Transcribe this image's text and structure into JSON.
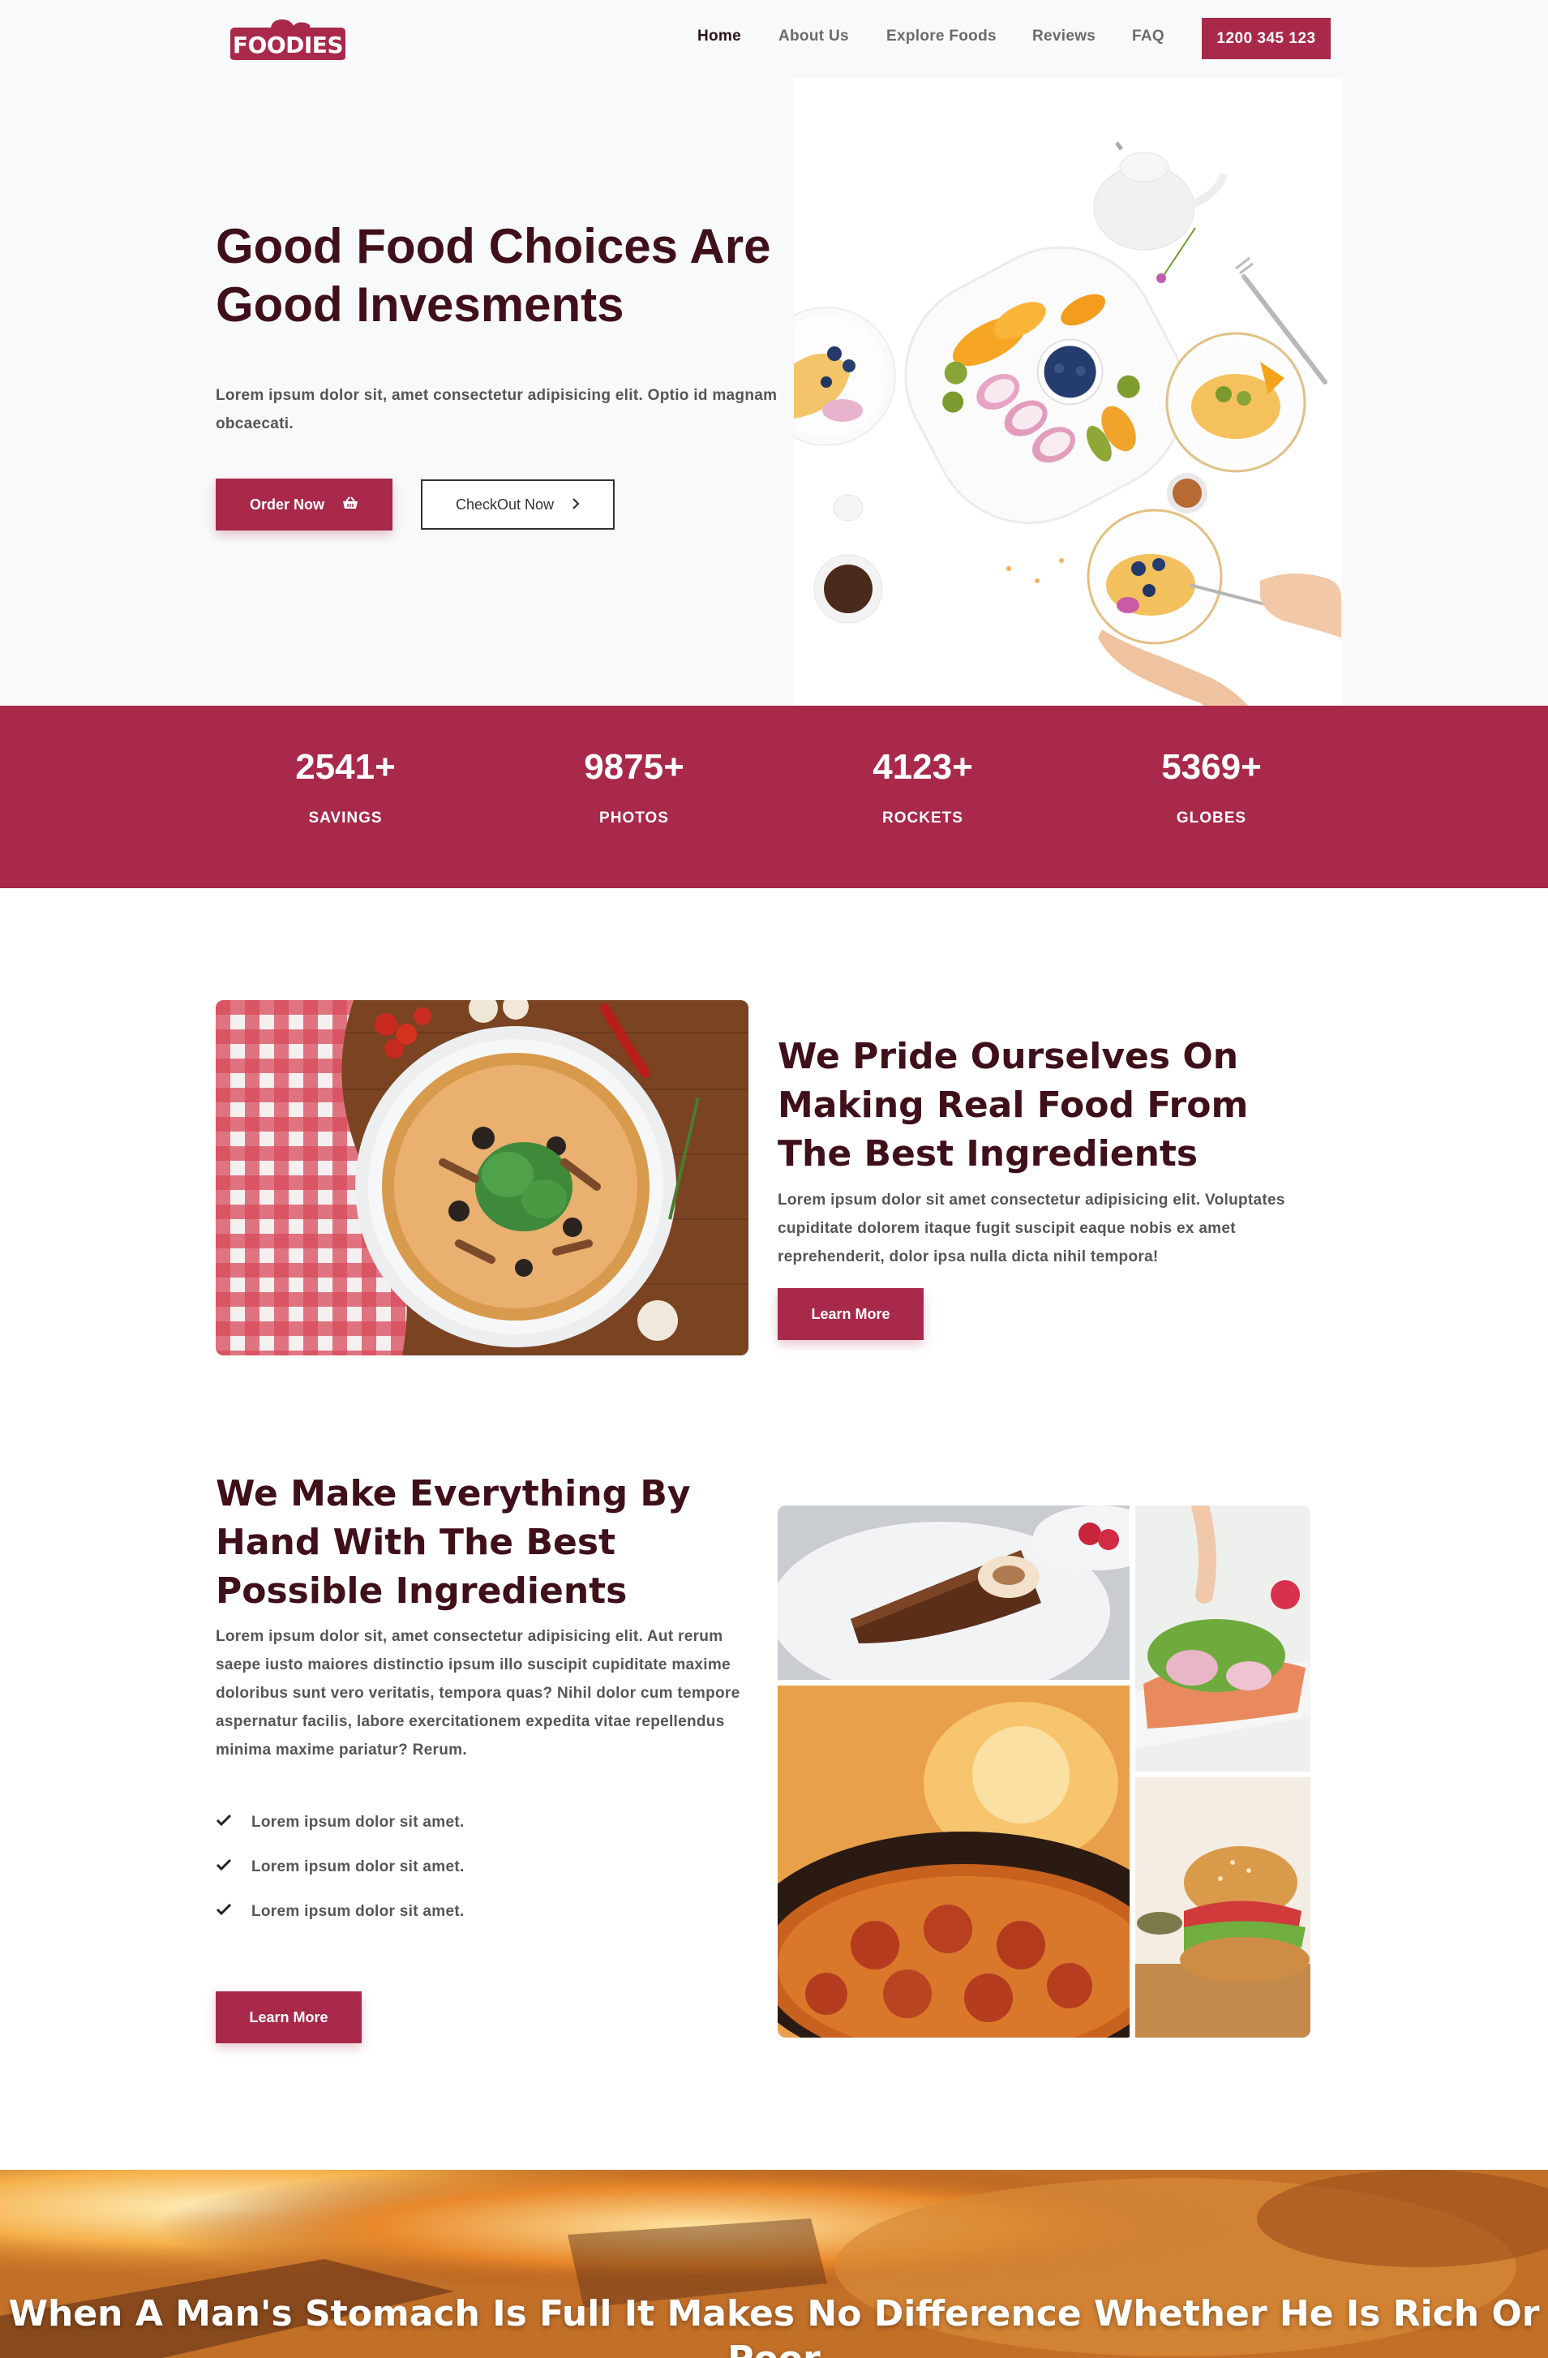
{
  "brand": {
    "logo_text": "FOODIES",
    "accent": "#a8294a",
    "heading_color": "#3f0f1a"
  },
  "nav": {
    "items": [
      {
        "label": "Home",
        "active": true
      },
      {
        "label": "About Us"
      },
      {
        "label": "Explore Foods"
      },
      {
        "label": "Reviews"
      },
      {
        "label": "FAQ"
      }
    ],
    "phone": "1200 345 123"
  },
  "hero": {
    "title_line1": "Good Food Choices Are",
    "title_line2": "Good Invesments",
    "text": "Lorem ipsum dolor sit, amet consectetur adipisicing elit. Optio id magnam obcaecati.",
    "order_label": "Order Now",
    "checkout_label": "CheckOut Now",
    "order_icon": "basket-icon",
    "checkout_icon": "chevron-right-icon"
  },
  "stats": [
    {
      "value": "2541+",
      "label": "SAVINGS"
    },
    {
      "value": "9875+",
      "label": "PHOTOS"
    },
    {
      "value": "4123+",
      "label": "ROCKETS"
    },
    {
      "value": "5369+",
      "label": "GLOBES"
    }
  ],
  "section1": {
    "title": "We Pride Ourselves On Making Real Food From The Best Ingredients",
    "text": "Lorem ipsum dolor sit amet consectetur adipisicing elit. Voluptates cupiditate dolorem itaque fugit suscipit eaque nobis ex amet reprehenderit, dolor ipsa nulla dicta nihil tempora!",
    "button": "Learn More"
  },
  "section2": {
    "title": "We Make Everything By Hand With The Best Possible Ingredients",
    "text": "Lorem ipsum dolor sit, amet consectetur adipisicing elit. Aut rerum saepe iusto maiores distinctio ipsum illo suscipit cupiditate maxime doloribus sunt vero veritatis, tempora quas? Nihil dolor cum tempore aspernatur facilis, labore exercitationem expedita vitae repellendus minima maxime pariatur? Rerum.",
    "list": [
      "Lorem ipsum dolor sit amet.",
      "Lorem ipsum dolor sit amet.",
      "Lorem ipsum dolor sit amet."
    ],
    "button": "Learn More"
  },
  "banner": {
    "quote": "When A Man's Stomach Is Full It Makes No Difference Whether He Is Rich Or Poor"
  }
}
